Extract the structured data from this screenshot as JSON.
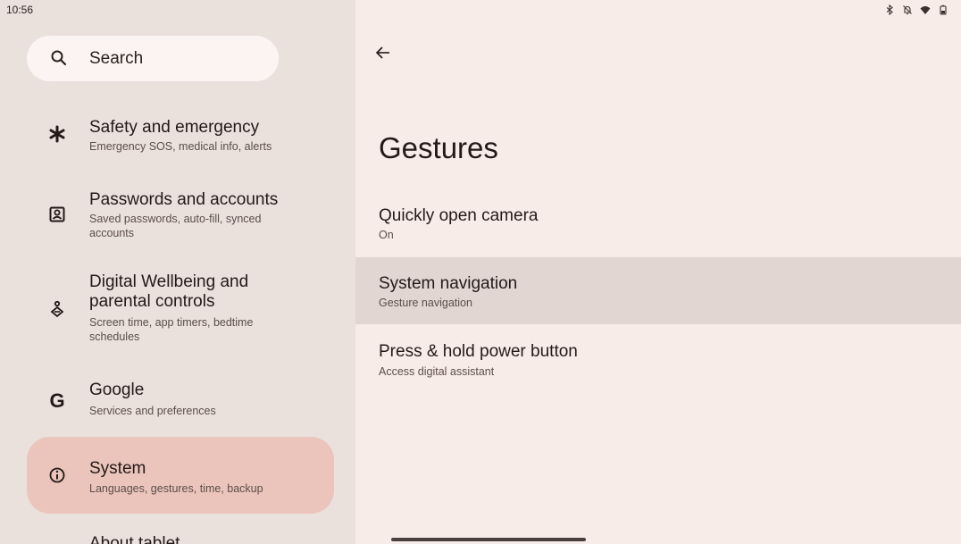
{
  "status_bar": {
    "time": "10:56",
    "icons": [
      "bluetooth-icon",
      "mute-icon",
      "wifi-icon",
      "battery-icon"
    ]
  },
  "left_pane": {
    "search": {
      "label": "Search",
      "icon": "search-icon"
    },
    "items": [
      {
        "icon": "asterisk-icon",
        "title": "Safety and emergency",
        "subtitle": "Emergency SOS, medical info, alerts"
      },
      {
        "icon": "account-box-icon",
        "title": "Passwords and accounts",
        "subtitle": "Saved passwords, auto-fill, synced accounts"
      },
      {
        "icon": "wellbeing-icon",
        "title": "Digital Wellbeing and parental controls",
        "subtitle": "Screen time, app timers, bedtime schedules"
      },
      {
        "icon": "google-icon",
        "title": "Google",
        "subtitle": "Services and preferences"
      },
      {
        "icon": "info-icon",
        "title": "System",
        "subtitle": "Languages, gestures, time, backup",
        "selected": true
      },
      {
        "icon": "tablet-icon",
        "title": "About tablet",
        "subtitle": ""
      }
    ]
  },
  "right_pane": {
    "title": "Gestures",
    "items": [
      {
        "title": "Quickly open camera",
        "summary": "On"
      },
      {
        "title": "System navigation",
        "summary": "Gesture navigation",
        "highlighted": true
      },
      {
        "title": "Press & hold power button",
        "summary": "Access digital assistant"
      }
    ]
  },
  "colors": {
    "left_bg": "#eae0dc",
    "right_bg": "#f8ece8",
    "selected_bg": "#ebc4bb",
    "highlight_bg": "#e2d6d2"
  }
}
